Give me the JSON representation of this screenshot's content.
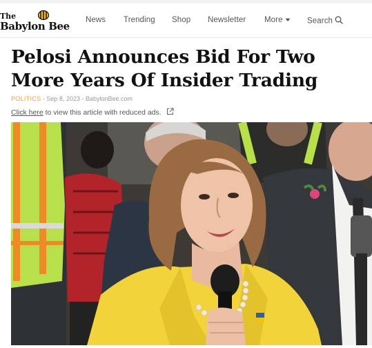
{
  "header": {
    "logo_the": "The",
    "logo_name": "Babylon Bee",
    "nav": [
      {
        "label": "News"
      },
      {
        "label": "Trending"
      },
      {
        "label": "Shop"
      },
      {
        "label": "Newsletter"
      },
      {
        "label": "More"
      },
      {
        "label": "Search"
      }
    ]
  },
  "article": {
    "title": "Pelosi Announces Bid For Two More Years Of Insider Trading",
    "category": "POLITICS",
    "separator": " - ",
    "date": "Sep 8, 2023",
    "site": "BabylonBee.com",
    "reduced_ads_link": "Click here",
    "reduced_ads_text": " to view this article with reduced ads."
  },
  "colors": {
    "category": "#e8a23b",
    "jacket_yellow": "#f2d33a",
    "vest_green": "#b8e04a",
    "vest_orange": "#f08a24"
  },
  "icons": [
    "bee-logo-icon",
    "chevron-down-icon",
    "search-icon",
    "external-link-icon"
  ]
}
